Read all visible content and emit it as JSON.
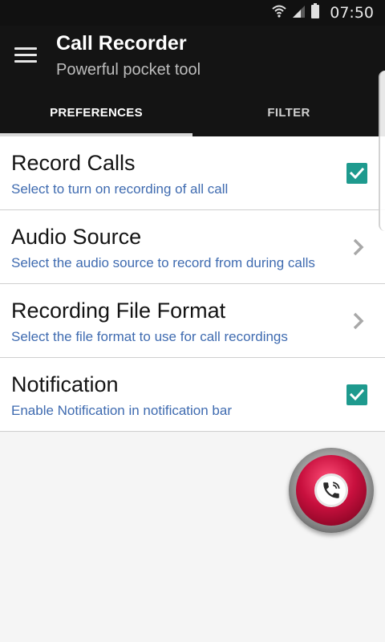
{
  "status_bar": {
    "time": "07:50",
    "icons": [
      "wifi-icon",
      "signal-icon",
      "battery-icon"
    ]
  },
  "app_bar": {
    "title": "Call Recorder",
    "subtitle": "Powerful pocket tool",
    "menu_icon": "hamburger-menu-icon"
  },
  "tabs": [
    {
      "label": "PREFERENCES",
      "active": true
    },
    {
      "label": "FILTER",
      "active": false
    }
  ],
  "preferences": [
    {
      "title": "Record Calls",
      "summary": "Select to turn on recording of all call",
      "control": "checkbox",
      "checked": true
    },
    {
      "title": "Audio Source",
      "summary": "Select the audio source to record from during calls",
      "control": "chevron"
    },
    {
      "title": "Recording File Format",
      "summary": "Select the file format to use for call recordings",
      "control": "chevron"
    },
    {
      "title": "Notification",
      "summary": "Enable Notification in notification bar",
      "control": "checkbox",
      "checked": true
    }
  ],
  "fab": {
    "icon": "phone-icon"
  },
  "colors": {
    "app_bar": "#141414",
    "accent": "#1e9a8e",
    "summary_text": "#3f6bb0",
    "fab_red": "#c8103e"
  }
}
